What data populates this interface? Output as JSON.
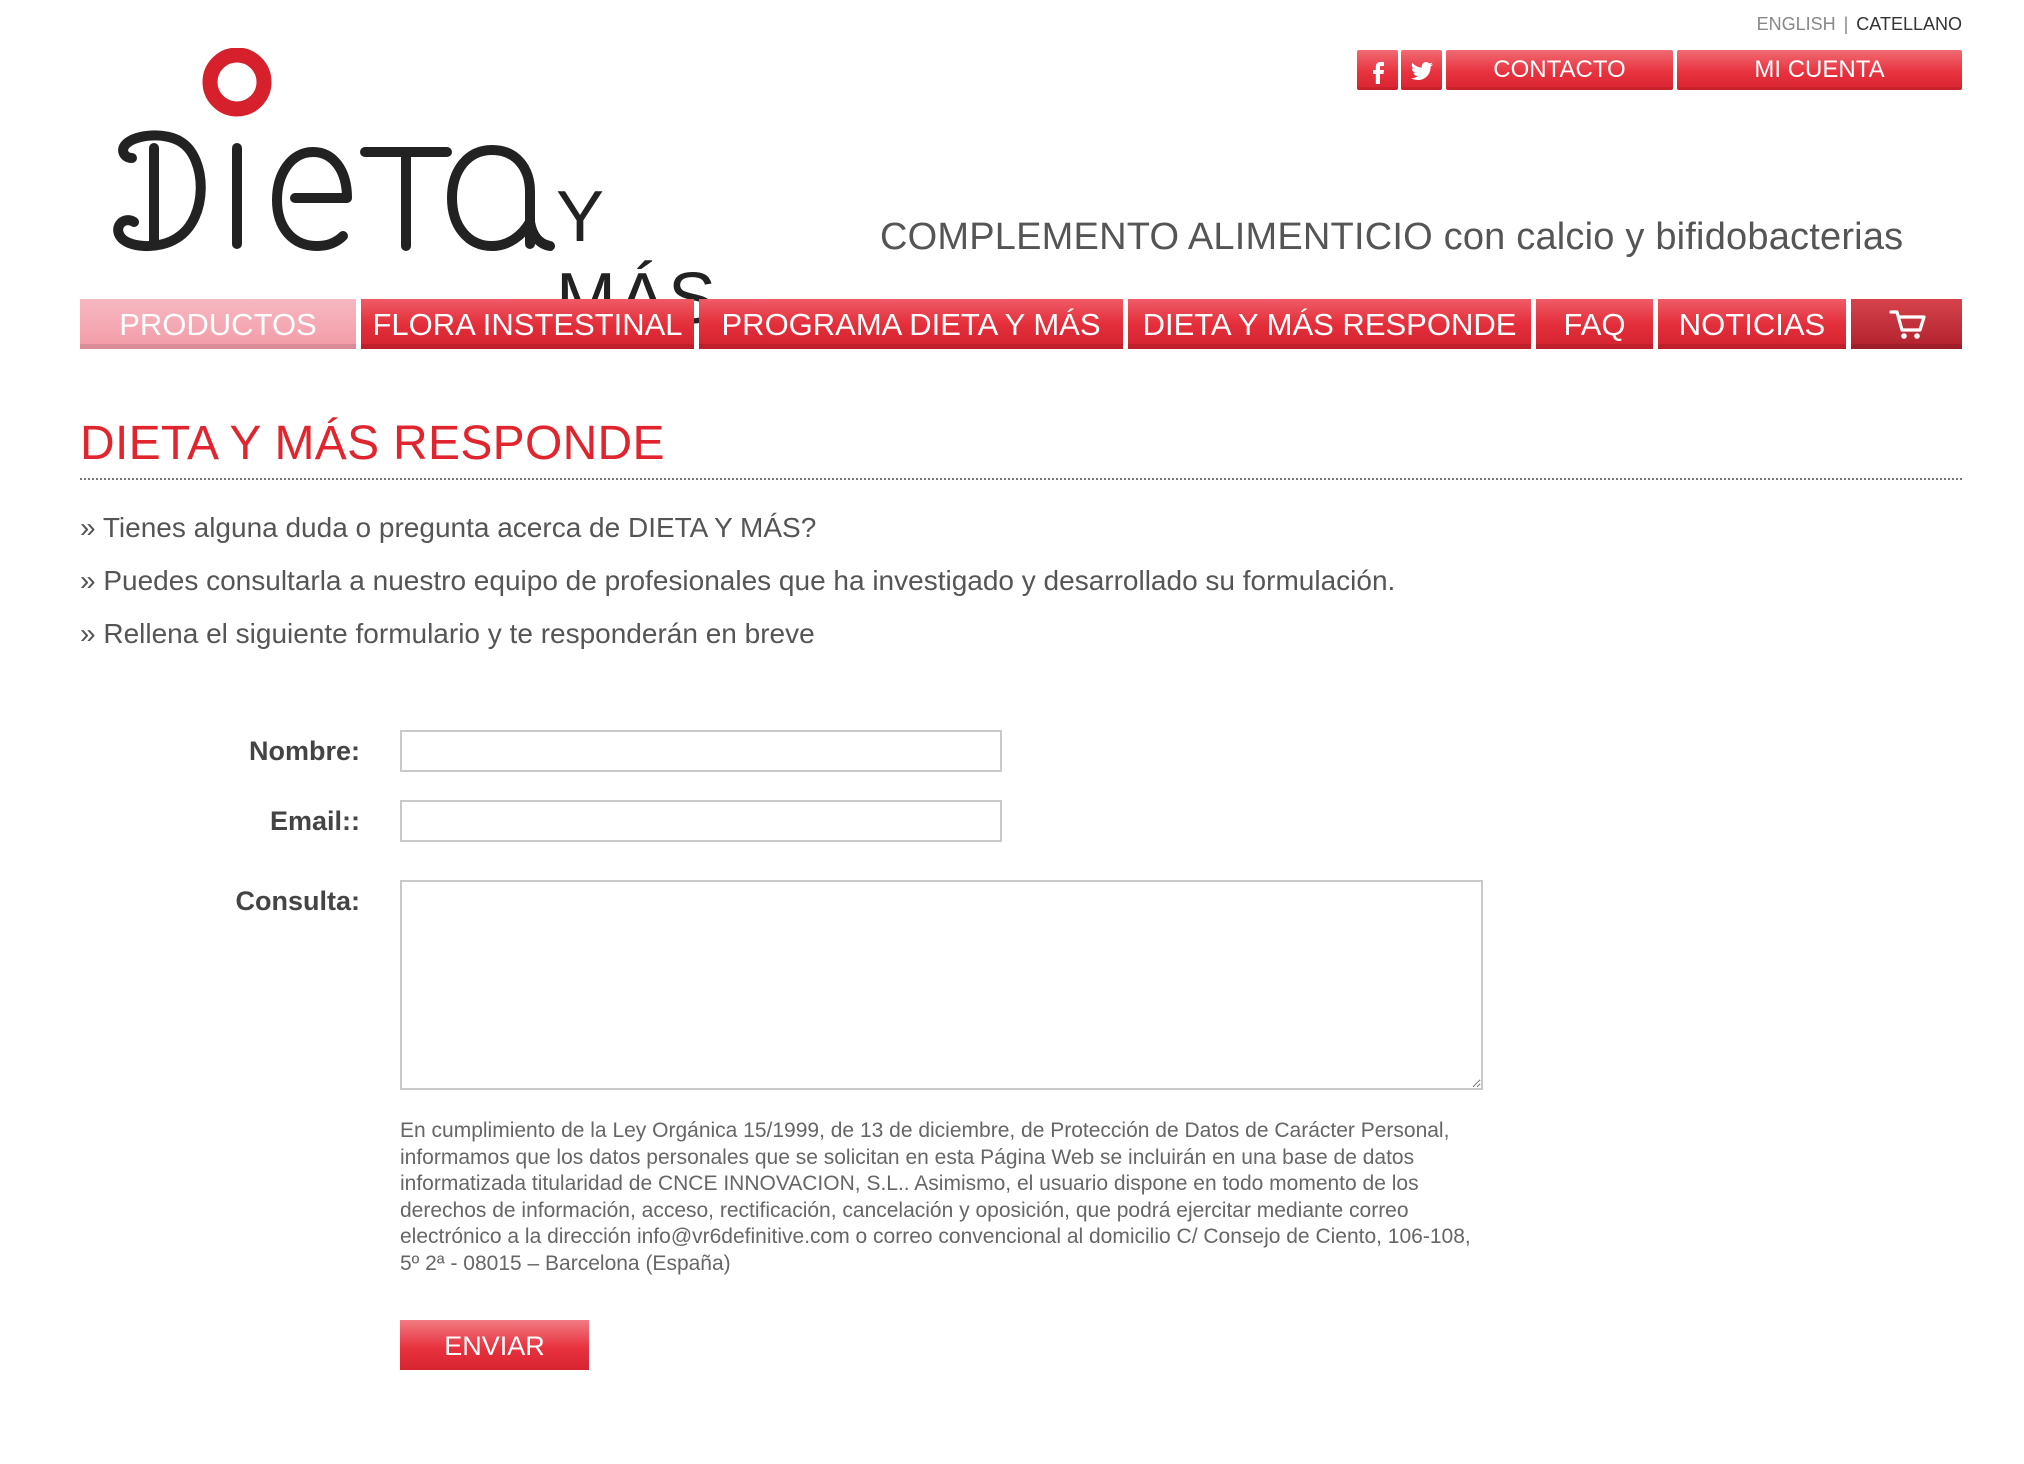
{
  "language": {
    "english": "ENGLISH",
    "separator": "|",
    "catalan": "CATELLANO"
  },
  "header": {
    "logo_text": "DIETA",
    "logo_suffix": "Y MÁS",
    "contact_label": "CONTACTO",
    "account_label": "MI CUENTA",
    "tagline": "COMPLEMENTO ALIMENTICIO con calcio y bifidobacterias"
  },
  "nav": {
    "items": [
      {
        "label": "PRODUCTOS",
        "active": true
      },
      {
        "label": "FLORA INSTESTINAL"
      },
      {
        "label": "PROGRAMA DIETA Y MÁS"
      },
      {
        "label": "DIETA Y MÁS RESPONDE"
      },
      {
        "label": "FAQ"
      },
      {
        "label": "NOTICIAS"
      }
    ],
    "cart_icon": "cart-icon"
  },
  "main": {
    "title": "DIETA Y MÁS RESPONDE",
    "intro": [
      "» Tienes alguna duda o pregunta acerca de DIETA Y MÁS?",
      "» Puedes consultarla a nuestro equipo de profesionales que ha investigado y desarrollado su formulación.",
      "» Rellena el siguiente formulario y te responderán en breve"
    ]
  },
  "form": {
    "name_label": "Nombre:",
    "name_value": "",
    "email_label": "Email::",
    "email_value": "",
    "query_label": "Consulta:",
    "query_value": "",
    "legal_text": "En cumplimiento de la Ley Orgánica 15/1999, de 13 de diciembre, de Protección de Datos de Carácter Personal, informamos que los datos personales que se solicitan en esta Página Web se incluirán en una base de datos informatizada titularidad de CNCE INNOVACION, S.L.. Asimismo, el usuario dispone en todo momento de los derechos de información, acceso, rectificación, cancelación y oposición, que podrá ejercitar mediante correo electrónico a la dirección info@vr6definitive.com o correo convencional al domicilio C/ Consejo de Ciento, 106-108, 5º 2ª - 08015 – Barcelona (España)",
    "submit_label": "ENVIAR"
  },
  "colors": {
    "brand_red": "#e0252f",
    "nav_active": "#f39ba7"
  }
}
